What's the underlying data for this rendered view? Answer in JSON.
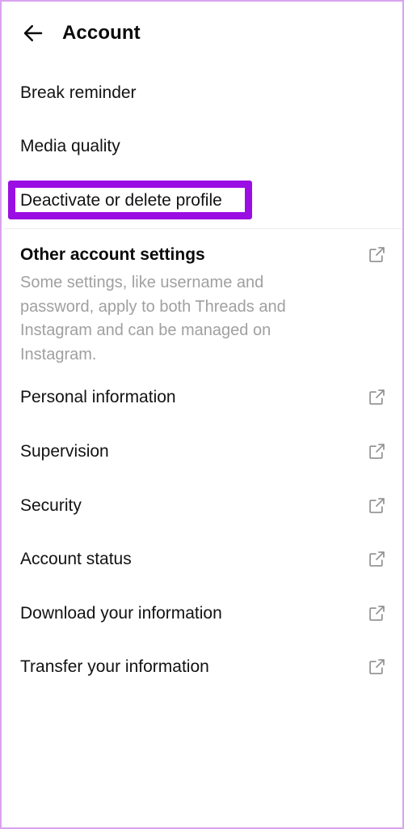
{
  "header": {
    "back_icon": "arrow-left-icon",
    "title": "Account"
  },
  "settings_list": {
    "items": [
      {
        "label": "Break reminder",
        "icon": null,
        "highlighted": false
      },
      {
        "label": "Media quality",
        "icon": null,
        "highlighted": false
      },
      {
        "label": "Deactivate or delete profile",
        "icon": null,
        "highlighted": true
      }
    ]
  },
  "other_account_settings": {
    "heading": "Other account settings",
    "icon": "external-link-icon",
    "description": "Some settings, like username and password, apply to both Threads and Instagram and can be managed on Instagram.",
    "items": [
      {
        "label": "Personal information",
        "icon": "external-link-icon"
      },
      {
        "label": "Supervision",
        "icon": "external-link-icon"
      },
      {
        "label": "Security",
        "icon": "external-link-icon"
      },
      {
        "label": "Account status",
        "icon": "external-link-icon"
      },
      {
        "label": "Download your information",
        "icon": "external-link-icon"
      },
      {
        "label": "Transfer your information",
        "icon": "external-link-icon"
      }
    ]
  },
  "annotation": {
    "type": "highlight-rectangle",
    "target": "Deactivate or delete profile",
    "color": "#9b0ee3"
  },
  "colors": {
    "frame_border": "#d9a3f0",
    "background": "#ffffff",
    "primary_text": "#121212",
    "secondary_text": "#a0a0a0",
    "icon": "#8e8e8e",
    "divider": "#ededed",
    "highlight": "#9b0ee3"
  }
}
